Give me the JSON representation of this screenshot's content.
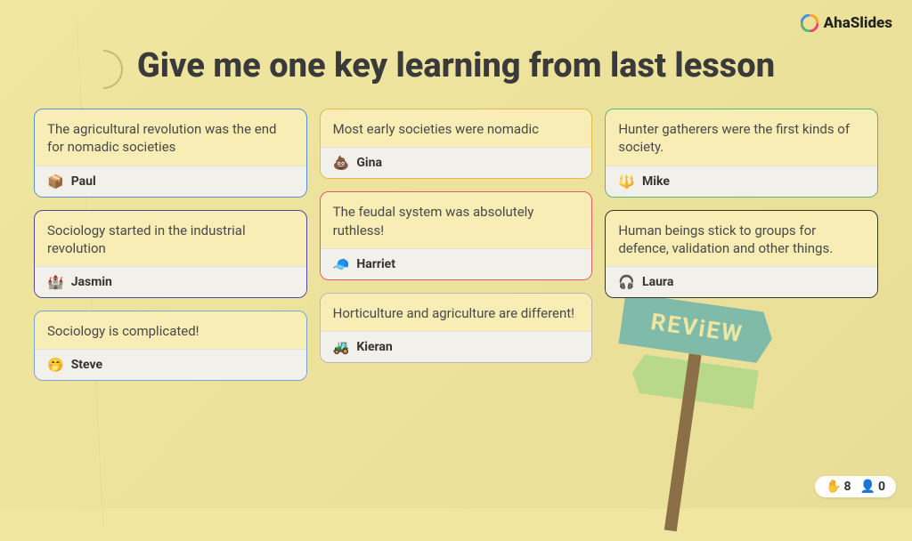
{
  "brand": "AhaSlides",
  "title": "Give me one key learning from last lesson",
  "signpost": "REViEW",
  "columns": [
    [
      {
        "text": "The agricultural revolution was the end for nomadic societies",
        "author": "Paul",
        "emoji": "📦",
        "border": "#5a8fd6"
      },
      {
        "text": "Sociology started in the industrial revolution",
        "author": "Jasmin",
        "emoji": "🏰",
        "border": "#4a4a9e"
      },
      {
        "text": "Sociology is complicated!",
        "author": "Steve",
        "emoji": "🤭",
        "border": "#7aa3d9"
      }
    ],
    [
      {
        "text": "Most early societies were nomadic",
        "author": "Gina",
        "emoji": "💩",
        "border": "#e6b84a"
      },
      {
        "text": "The feudal system was absolutely ruthless!",
        "author": "Harriet",
        "emoji": "🧢",
        "border": "#e05a6e"
      },
      {
        "text": "Horticulture and agriculture are different!",
        "author": "Kieran",
        "emoji": "🚜",
        "border": "#b8b8b8"
      }
    ],
    [
      {
        "text": "Hunter gatherers were the first kinds of society.",
        "author": "Mike",
        "emoji": "🔱",
        "border": "#5ab874"
      },
      {
        "text": "Human beings stick to groups for defence, validation and other things.",
        "author": "Laura",
        "emoji": "🎧",
        "border": "#333333"
      }
    ]
  ],
  "footer": {
    "hand_count": "8",
    "user_count": "0"
  }
}
